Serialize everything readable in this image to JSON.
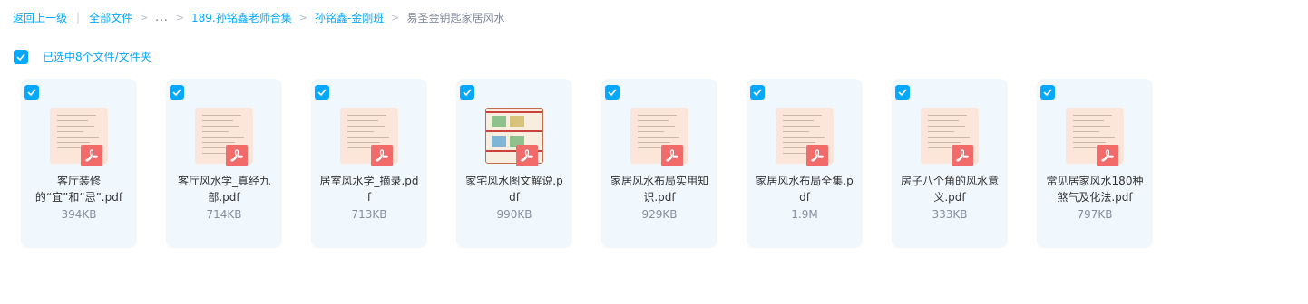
{
  "breadcrumb": {
    "back": "返回上一级",
    "all_files": "全部文件",
    "ellipsis": "...",
    "folder1": "189.孙铭鑫老师合集",
    "folder2": "孙铭鑫-金刚班",
    "current": "易圣金钥匙家居风水"
  },
  "selection": {
    "text": "已选中8个文件/文件夹",
    "accent": "#06a7ff"
  },
  "files": [
    {
      "name": "客厅装修的“宜”和“忌”.pdf",
      "size": "394KB",
      "icon": "pdf-icon"
    },
    {
      "name": "客厅风水学_真经九部.pdf",
      "size": "714KB",
      "icon": "pdf-icon"
    },
    {
      "name": "居室风水学_摘录.pdf",
      "size": "713KB",
      "icon": "pdf-icon"
    },
    {
      "name": "家宅风水图文解说.pdf",
      "size": "990KB",
      "icon": "pdf-icon"
    },
    {
      "name": "家居风水布局实用知识.pdf",
      "size": "929KB",
      "icon": "pdf-icon"
    },
    {
      "name": "家居风水布局全集.pdf",
      "size": "1.9M",
      "icon": "pdf-icon"
    },
    {
      "name": "房子八个角的风水意义.pdf",
      "size": "333KB",
      "icon": "pdf-icon"
    },
    {
      "name": "常见居家风水180种煞气及化法.pdf",
      "size": "797KB",
      "icon": "pdf-icon"
    }
  ]
}
